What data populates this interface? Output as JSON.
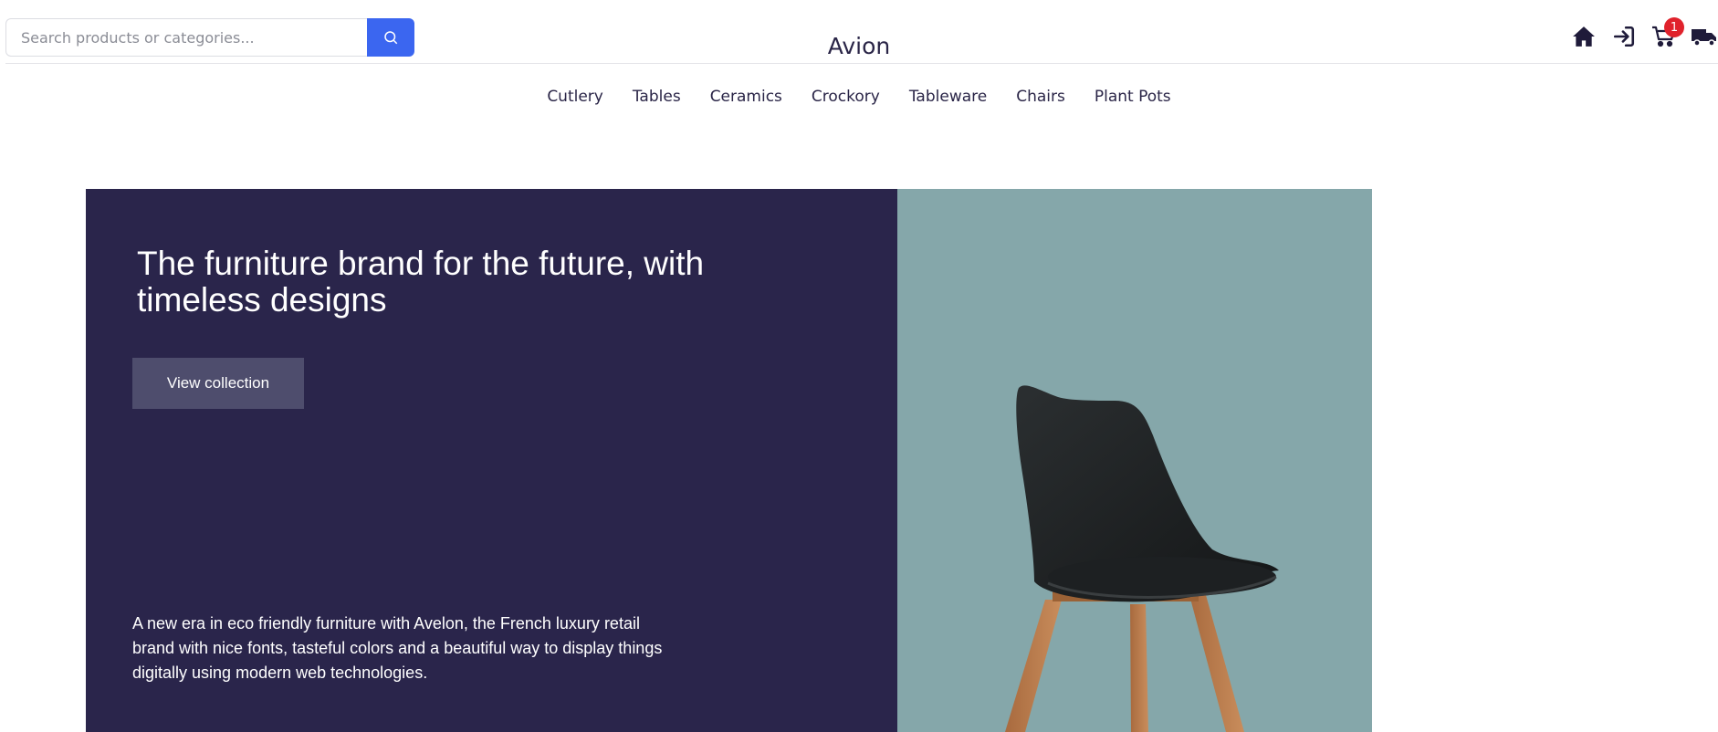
{
  "search": {
    "placeholder": "Search products or categories..."
  },
  "brand": "Avion",
  "header_icons": [
    {
      "name": "home-icon"
    },
    {
      "name": "login-icon"
    },
    {
      "name": "cart-icon",
      "badge": "1"
    },
    {
      "name": "delivery-truck-icon"
    }
  ],
  "nav": [
    "Cutlery",
    "Tables",
    "Ceramics",
    "Crockory",
    "Tableware",
    "Chairs",
    "Plant Pots"
  ],
  "hero": {
    "title": "The furniture brand for the future, with timeless designs",
    "cta": "View collection",
    "description": "A new era in eco friendly furniture with Avelon, the French luxury retail brand with nice fonts, tasteful colors and a beautiful way to display things digitally using modern web technologies."
  },
  "colors": {
    "search_button": "#3b66f0",
    "hero_dark": "#2a254b",
    "hero_image_bg": "#85a7aa",
    "cta_bg": "#4e4d6d",
    "badge": "#e0222c"
  }
}
